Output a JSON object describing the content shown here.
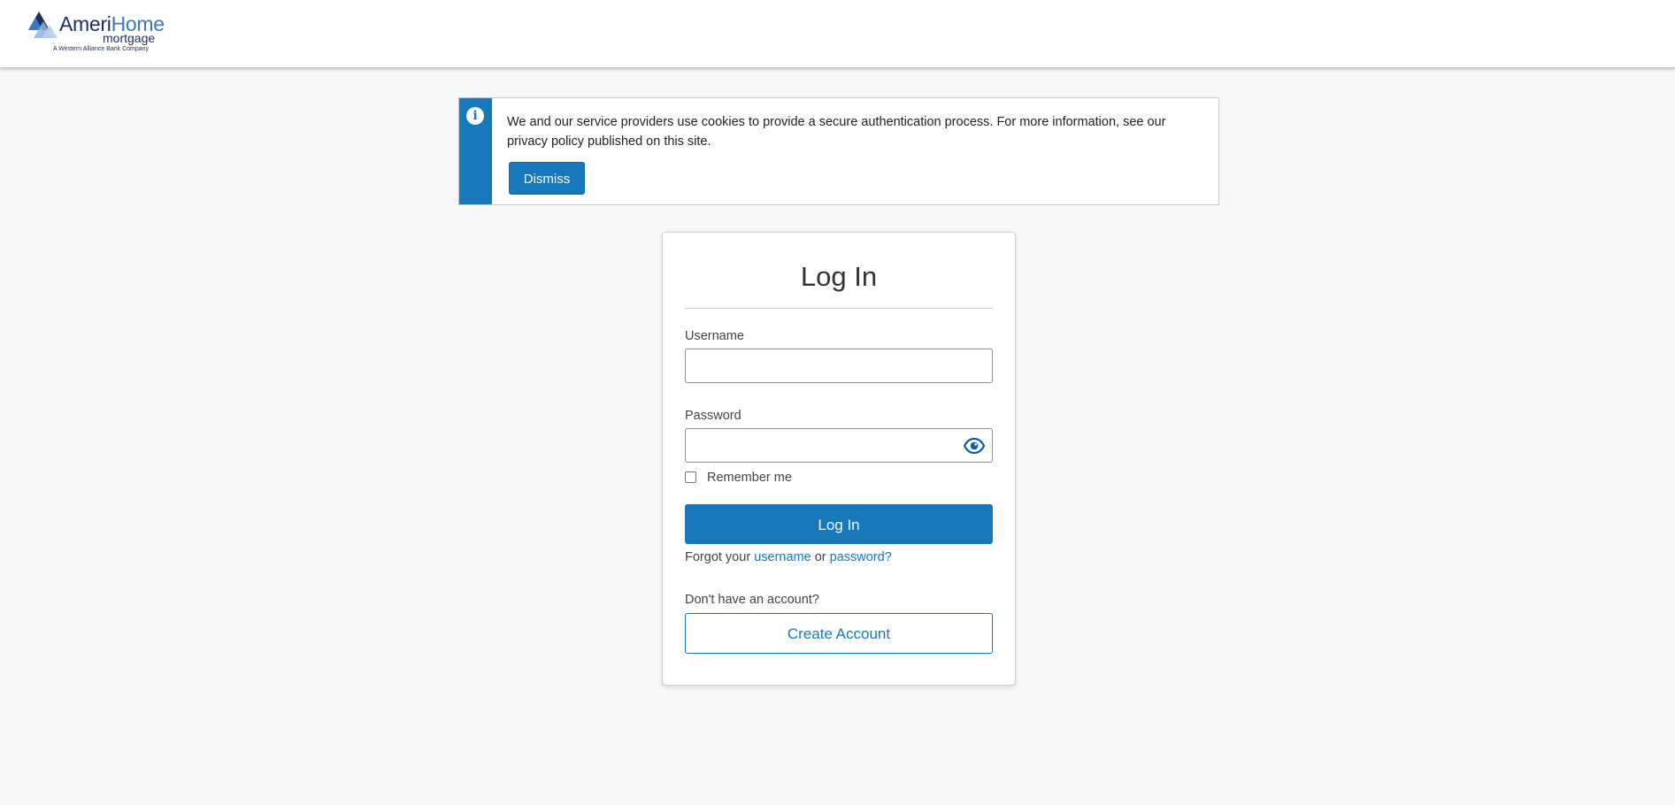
{
  "header": {
    "logo": {
      "ameri": "Ameri",
      "home": "Home",
      "mortgage": "mortgage",
      "tagline": "A Western Alliance Bank Company",
      "colors": {
        "navy": "#1f2d5c",
        "blue": "#3a79c1",
        "light_blue": "#8fb4de"
      }
    }
  },
  "notice": {
    "icon": "info-icon",
    "text": "We and our service providers use cookies to provide a secure authentication process. For more information, see our privacy policy published on this site.",
    "dismiss_label": "Dismiss",
    "accent_color": "#1878bc"
  },
  "login": {
    "title": "Log In",
    "username_label": "Username",
    "username_value": "",
    "password_label": "Password",
    "password_value": "",
    "password_toggle_icon": "eye-icon",
    "remember_label": "Remember me",
    "remember_checked": false,
    "submit_label": "Log In",
    "forgot_prefix": "Forgot your",
    "forgot_username": "username",
    "forgot_or": "or",
    "forgot_password": "password?",
    "no_account_text": "Don't have an account?",
    "create_account_label": "Create Account",
    "primary_color": "#1878bc"
  }
}
